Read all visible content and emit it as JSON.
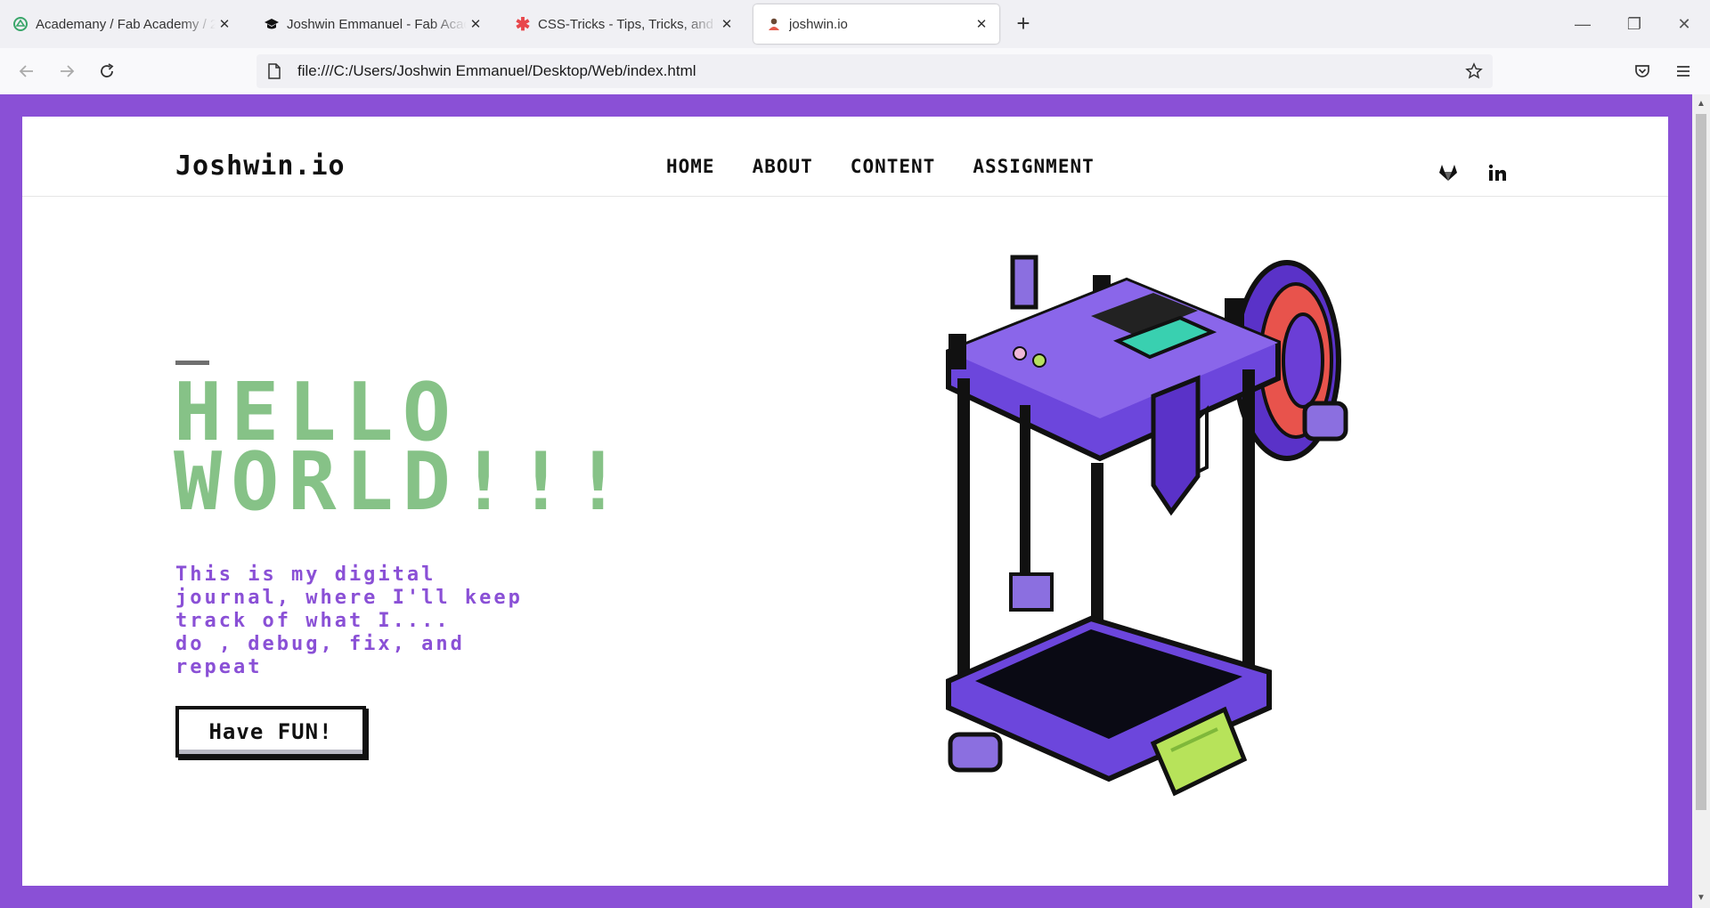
{
  "tabs": [
    {
      "title": "Academany / Fab Academy / 20",
      "icon": "academany-logo-icon"
    },
    {
      "title": "Joshwin Emmanuel - Fab Acade",
      "icon": "graduation-cap-icon"
    },
    {
      "title": "CSS-Tricks - Tips, Tricks, and Tec",
      "icon": "css-tricks-star-icon"
    },
    {
      "title": "joshwin.io",
      "icon": "user-favicon-icon"
    }
  ],
  "address_bar": {
    "url": "file:///C:/Users/Joshwin Emmanuel/Desktop/Web/index.html"
  },
  "site": {
    "logo": "Joshwin.io",
    "nav": [
      "HOME",
      "ABOUT",
      "CONTENT",
      "ASSIGNMENT"
    ],
    "social": [
      "gitlab-icon",
      "linkedin-icon"
    ]
  },
  "hero": {
    "headline": "HELLO\nWORLD!!!",
    "intro": "This is my digital\njournal, where I'll keep\ntrack of what I....\ndo , debug, fix, and\nrepeat",
    "button": "Have FUN!"
  },
  "colors": {
    "frame": "#8a50d6",
    "headline": "#86c287",
    "intro": "#8a50d6"
  }
}
